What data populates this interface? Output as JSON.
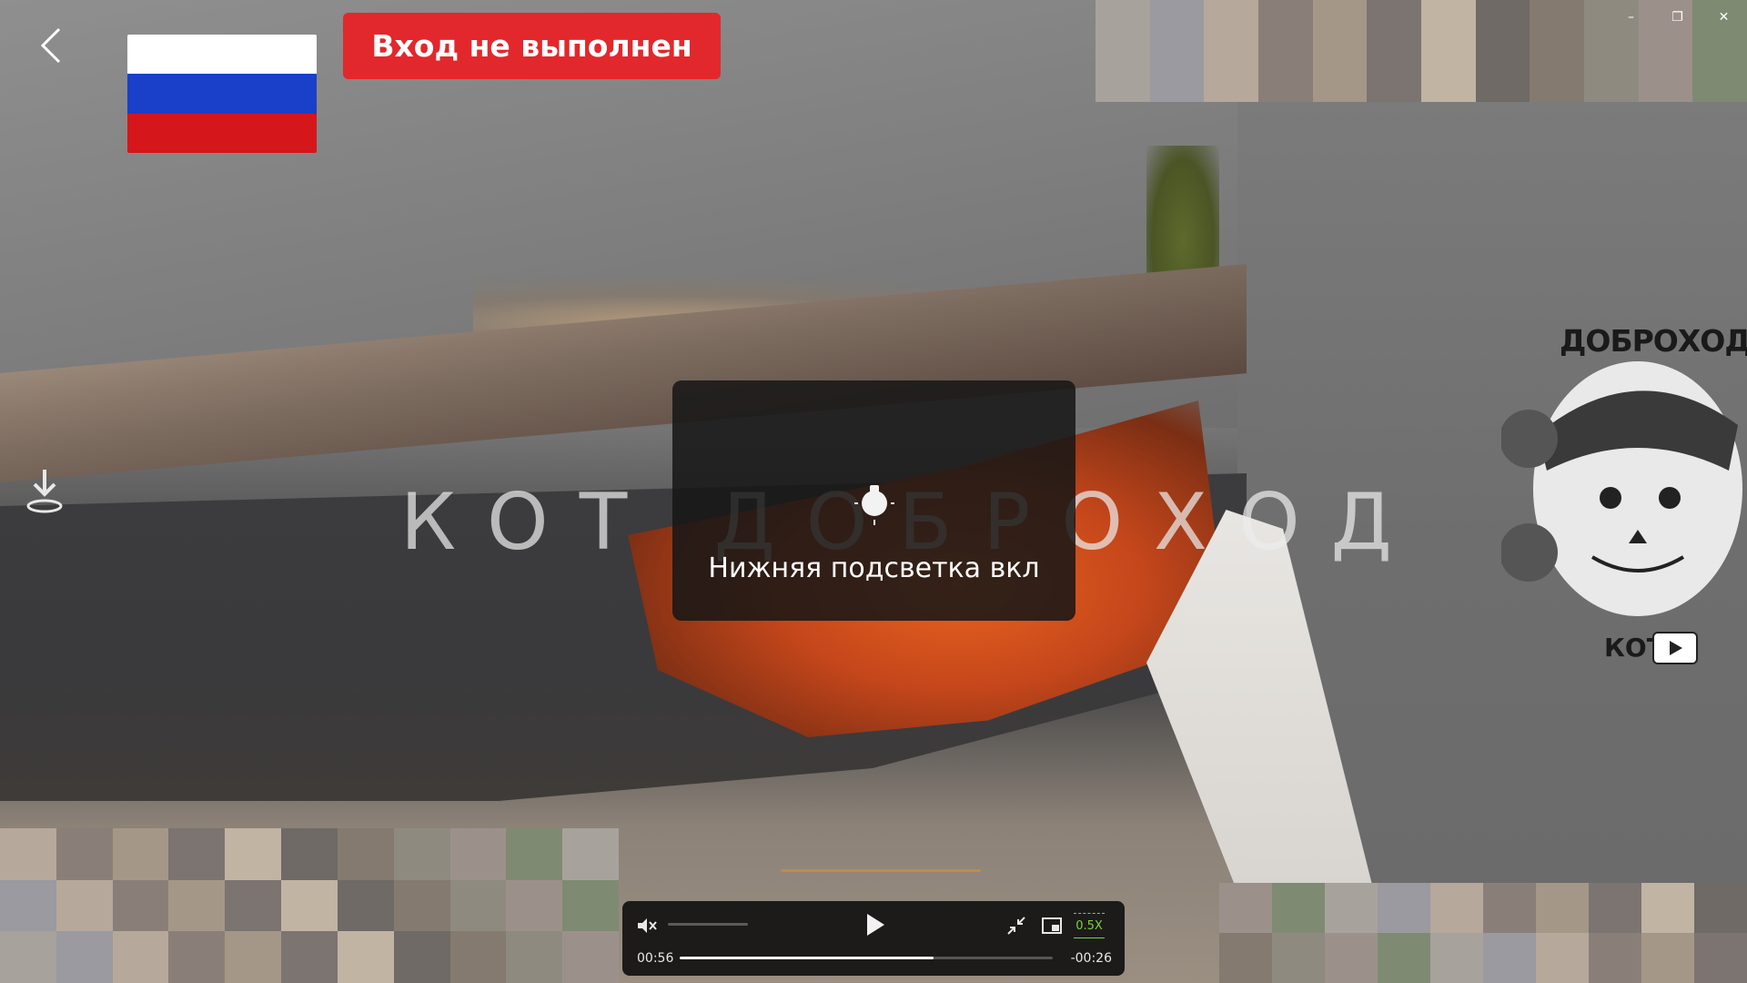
{
  "window": {
    "controls": {
      "minimize": "–",
      "restore": "❐",
      "close": "✕"
    }
  },
  "overlay": {
    "login_status": "Вход не выполнен",
    "flag": {
      "colors": [
        "#ffffff",
        "#1a3fc9",
        "#d5161b"
      ]
    }
  },
  "watermark": {
    "text": "КОТ ДОБРОХОД"
  },
  "toast": {
    "icon": "light-bulb-icon",
    "text": "Нижняя подсветка вкл"
  },
  "brand": {
    "name": "ДОБРОХОД",
    "sub": "КОТ",
    "icon": "youtube-play-icon"
  },
  "player": {
    "current_time": "00:56",
    "remaining_time": "-00:26",
    "progress": 0.68,
    "volume": 0.0,
    "muted": true,
    "speed": "0.5X",
    "icons": {
      "mute": "speaker-muted-icon",
      "play": "play-icon",
      "collapse": "collapse-icon",
      "pip": "picture-in-picture-icon"
    }
  },
  "colors": {
    "banner": "#e2282c",
    "player_bg": "#121212",
    "speed_accent": "#7fcf3a"
  }
}
